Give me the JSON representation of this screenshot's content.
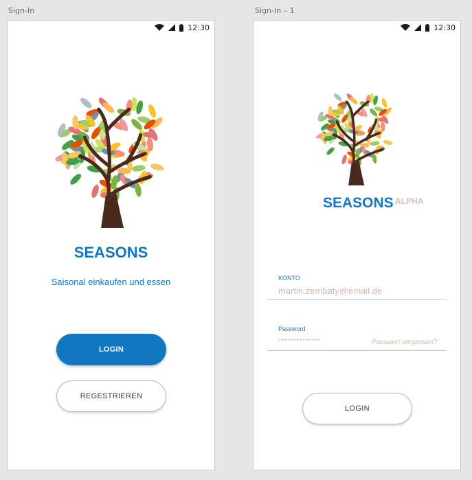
{
  "artboards": [
    {
      "label": "Sign-In"
    },
    {
      "label": "Sign-In – 1"
    }
  ],
  "status_bar": {
    "time": "12:30",
    "icons": [
      "wifi-icon",
      "cell-signal-icon",
      "battery-icon"
    ]
  },
  "signin": {
    "brand": "SEASONS",
    "tagline": "Saisonal einkaufen und essen",
    "login_label": "LOGIN",
    "register_label": "REGESTRIEREN"
  },
  "signin_form": {
    "brand": "SEASONS",
    "badge": "ALPHA",
    "account_label": "KONTO",
    "account_value": "martin.zembaty@email.de",
    "password_label": "Password",
    "password_value": "**************",
    "forgot_label": "Passwort vergessen?",
    "login_label": "LOGIN"
  },
  "colors": {
    "brand": "#1277c1",
    "muted": "#d1b9ab"
  }
}
